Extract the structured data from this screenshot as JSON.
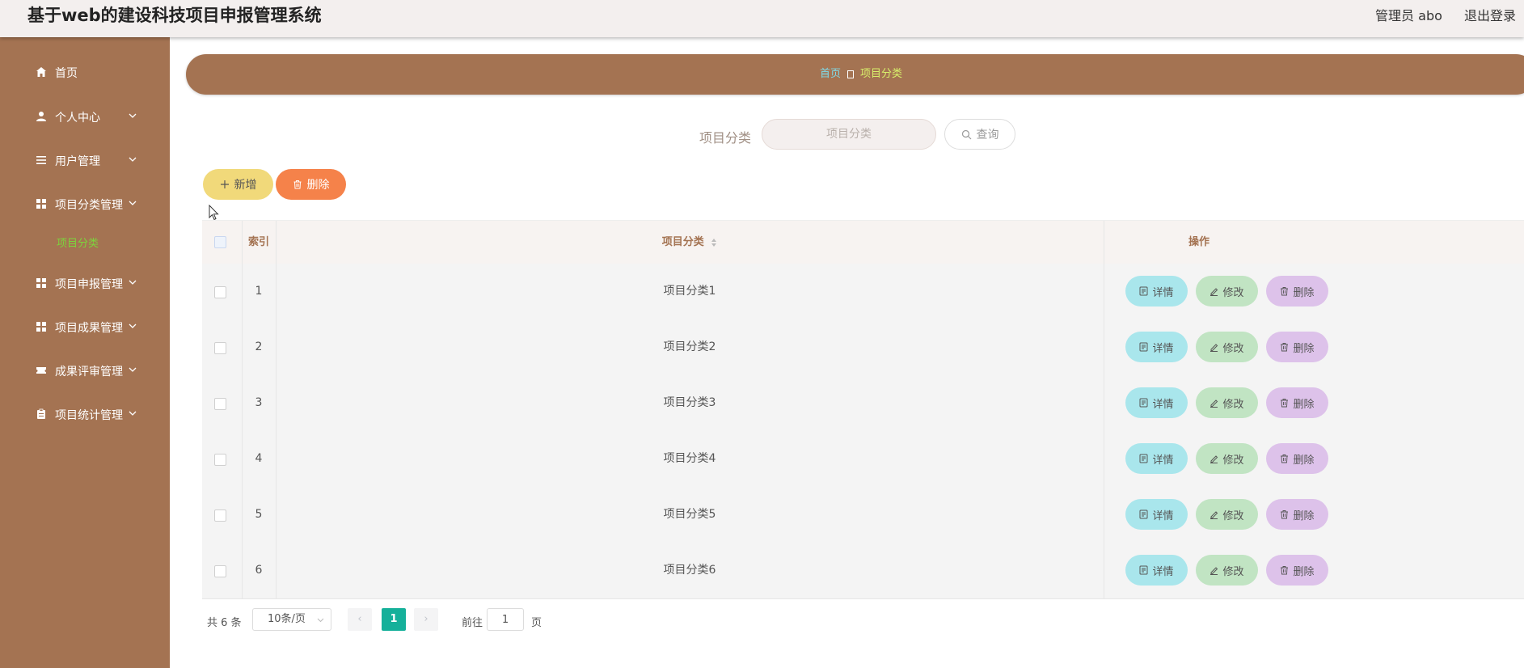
{
  "header": {
    "title": "基于web的建设科技项目申报管理系统",
    "user": "管理员 abo",
    "logout": "退出登录"
  },
  "sidebar": {
    "items": [
      {
        "label": "首页",
        "icon": "home-icon"
      },
      {
        "label": "个人中心",
        "icon": "user-icon"
      },
      {
        "label": "用户管理",
        "icon": "list-icon"
      },
      {
        "label": "项目分类管理",
        "icon": "grid-icon"
      },
      {
        "label": "项目申报管理",
        "icon": "grid-icon"
      },
      {
        "label": "项目成果管理",
        "icon": "grid-icon"
      },
      {
        "label": "成果评审管理",
        "icon": "ticket-icon"
      },
      {
        "label": "项目统计管理",
        "icon": "clipboard-icon"
      }
    ],
    "active_sub": "项目分类"
  },
  "breadcrumb": {
    "home": "首页",
    "current": "项目分类"
  },
  "search": {
    "label": "项目分类",
    "placeholder": "项目分类",
    "button": "查询"
  },
  "toolbar": {
    "add": "新增",
    "delete": "删除"
  },
  "table": {
    "headers": {
      "index": "索引",
      "category": "项目分类",
      "actions": "操作"
    },
    "rows": [
      {
        "index": "1",
        "category": "项目分类1"
      },
      {
        "index": "2",
        "category": "项目分类2"
      },
      {
        "index": "3",
        "category": "项目分类3"
      },
      {
        "index": "4",
        "category": "项目分类4"
      },
      {
        "index": "5",
        "category": "项目分类5"
      },
      {
        "index": "6",
        "category": "项目分类6"
      }
    ],
    "actions": {
      "detail": "详情",
      "edit": "修改",
      "delete": "删除"
    }
  },
  "pagination": {
    "total": "共 6 条",
    "page_size": "10条/页",
    "current_page": "1",
    "goto_prefix": "前往",
    "goto_value": "1",
    "goto_suffix": "页"
  },
  "colors": {
    "sidebar_bg": "#a47352",
    "active_sub": "#7cd43c",
    "add_btn": "#f1d97a",
    "delete_btn": "#f5824a",
    "detail_btn": "#a9e6ec",
    "edit_btn": "#c1e4c3",
    "row_delete_btn": "#ddc2ea",
    "page_active": "#15b09a"
  }
}
